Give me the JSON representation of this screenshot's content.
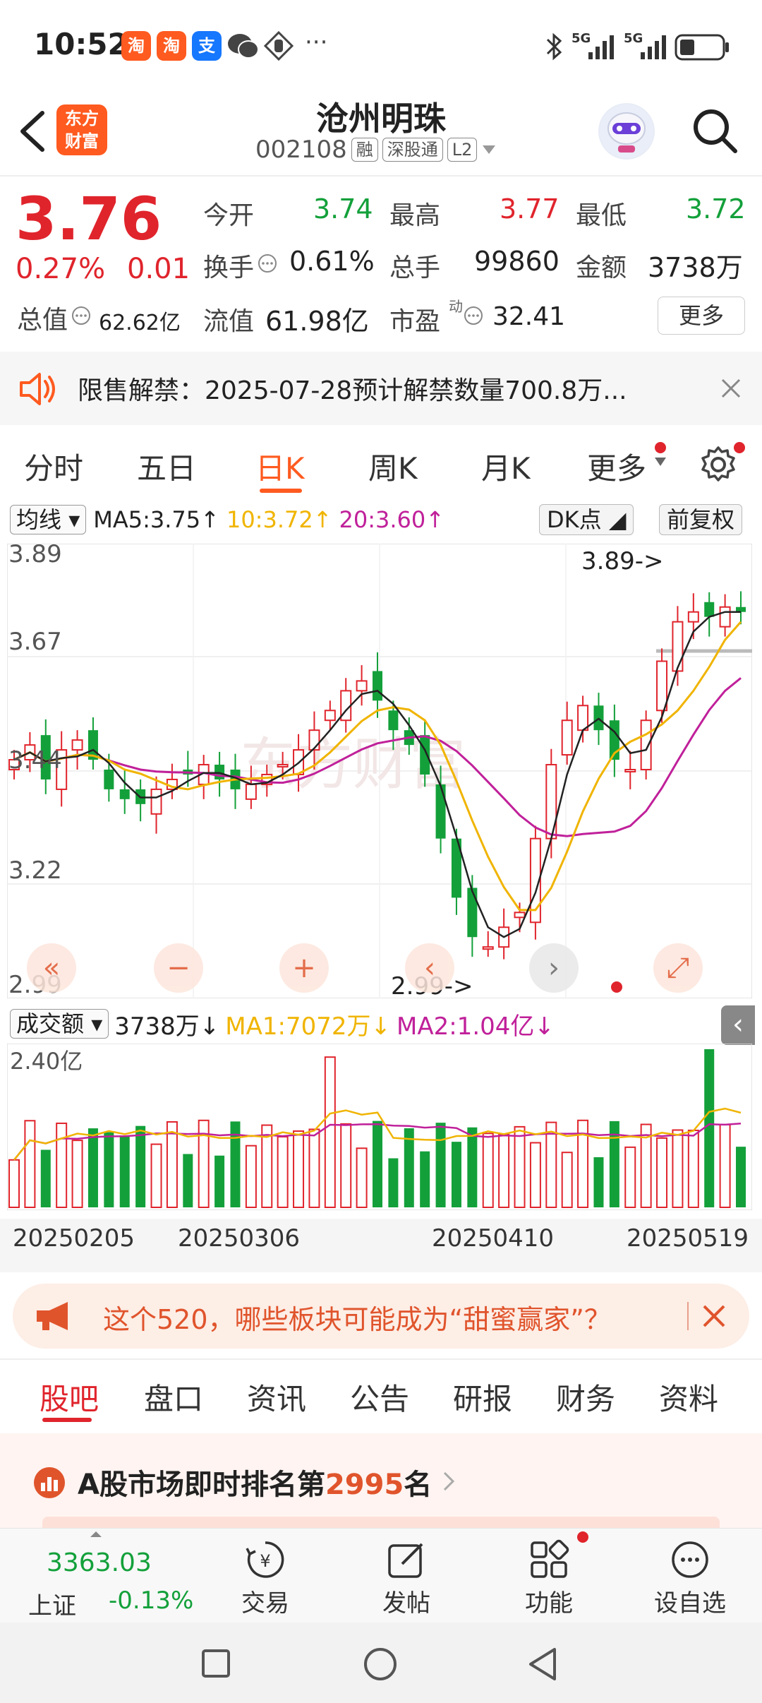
{
  "status_bar": {
    "time": "10:52",
    "app_icons": [
      {
        "name": "taobao-icon",
        "glyph": "淘",
        "color": "#ff5a1f"
      },
      {
        "name": "taobao-icon-2",
        "glyph": "淘",
        "color": "#ff5a1f"
      },
      {
        "name": "alipay-icon",
        "glyph": "支",
        "color": "#1677ff"
      }
    ],
    "signal_left": "5G",
    "signal_right": "5G",
    "more": "···"
  },
  "header": {
    "logo_line1": "东方",
    "logo_line2": "财富",
    "stock_name": "沧州明珠",
    "stock_code": "002108",
    "tags": [
      "融",
      "深股通",
      "L2"
    ]
  },
  "quote": {
    "price": "3.76",
    "change_pct": "0.27%",
    "change": "0.01",
    "open_label": "今开",
    "open": "3.74",
    "high_label": "最高",
    "high": "3.77",
    "low_label": "最低",
    "low": "3.72",
    "turnover_label": "换手",
    "turnover": "0.61%",
    "volume_label": "总手",
    "volume": "99860",
    "amount_label": "金额",
    "amount": "3738万",
    "total_value_label": "总值",
    "total_value": "62.62亿",
    "float_value_label": "流值",
    "float_value": "61.98亿",
    "pe_label": "市盈",
    "pe_sup": "动",
    "pe": "32.41",
    "more_label": "更多"
  },
  "notice": {
    "text": "限售解禁：2025-07-28预计解禁数量700.8万..."
  },
  "chart_tabs": {
    "items": [
      "分时",
      "五日",
      "日K",
      "周K",
      "月K",
      "更多"
    ],
    "active_index": 2
  },
  "ma_row": {
    "selector": "均线",
    "ma5": "MA5:3.75",
    "ma10": "10:3.72",
    "ma20": "20:3.60",
    "arrow": "↑",
    "dk": "DK点",
    "fq": "前复权",
    "ma5_color": "#222222",
    "ma10_color": "#f0b400",
    "ma20_color": "#c0209a"
  },
  "kchart": {
    "y_labels": [
      "3.89",
      "3.67",
      "3.44",
      "3.22",
      "2.99"
    ],
    "high_annot": "3.89->",
    "low_annot": "2.99->",
    "watermark": "东方财富"
  },
  "vol_row": {
    "selector": "成交额",
    "value": "3738万",
    "ma1": "MA1:7072万",
    "ma2": "MA2:1.04亿",
    "arrow": "↓",
    "y_label": "2.40亿"
  },
  "dates": [
    "20250205",
    "20250306",
    "20250410",
    "20250519"
  ],
  "banner": {
    "text": "这个520，哪些板块可能成为“甜蜜赢家”？"
  },
  "bottom_tabs": {
    "items": [
      "股吧",
      "盘口",
      "资讯",
      "公告",
      "研报",
      "财务",
      "资料"
    ],
    "active_index": 0
  },
  "rank": {
    "prefix": "A股市场即时排名第",
    "number": "2995",
    "suffix": "名"
  },
  "bottom_nav": {
    "index_value": "3363.03",
    "index_name": "上证",
    "index_change": "-0.13%",
    "items": [
      {
        "label": "交易",
        "icon": "trade-icon"
      },
      {
        "label": "发帖",
        "icon": "post-icon"
      },
      {
        "label": "功能",
        "icon": "function-icon"
      },
      {
        "label": "设自选",
        "icon": "favorite-icon"
      }
    ]
  },
  "colors": {
    "up": "#e0242c",
    "down": "#13a03a",
    "accent": "#ff5a1f"
  }
}
